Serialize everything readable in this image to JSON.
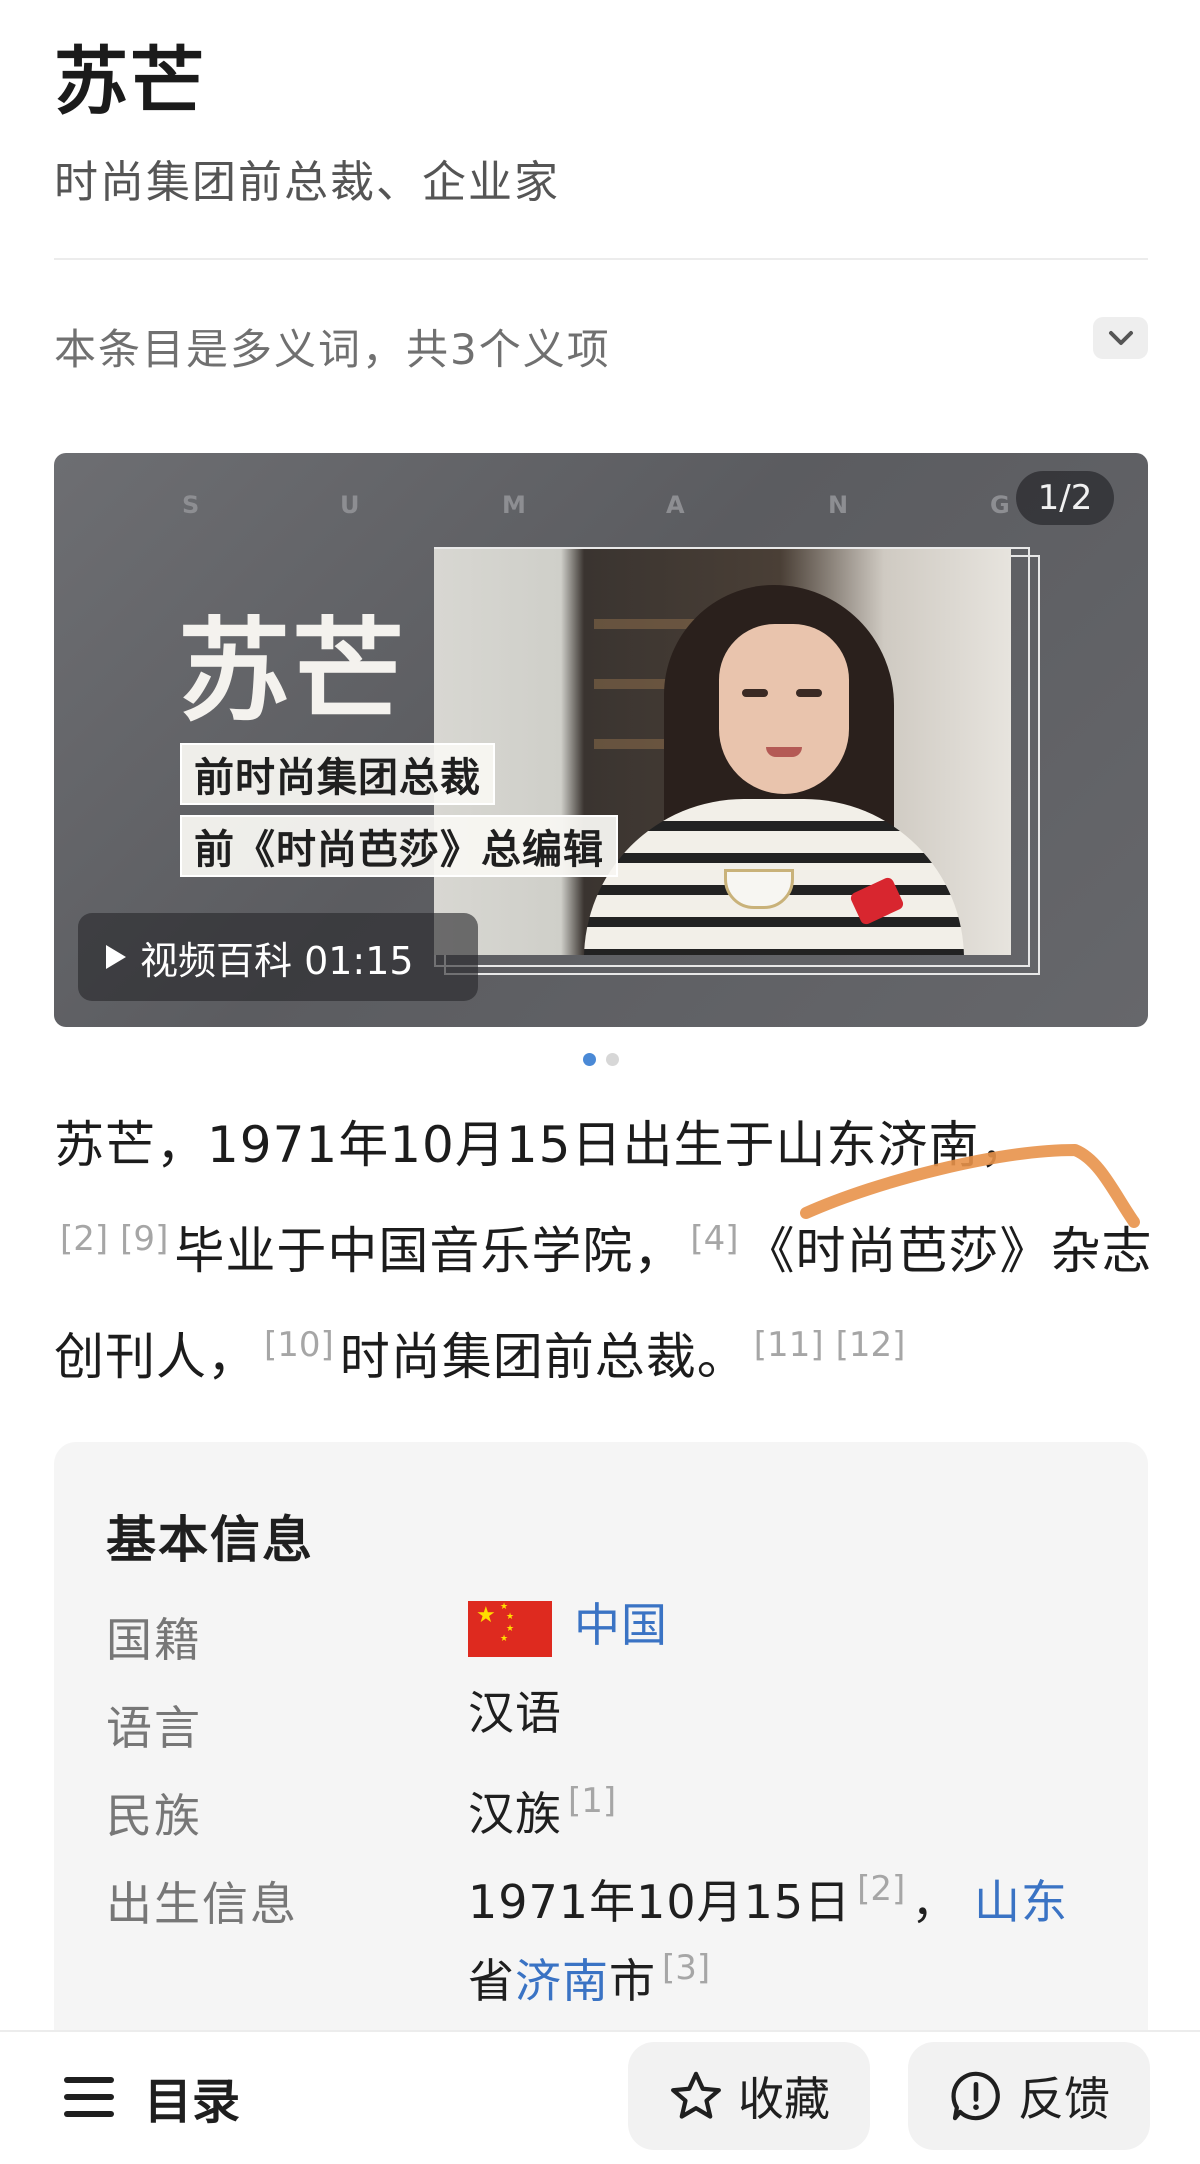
{
  "header": {
    "title": "苏芒",
    "subtitle": "时尚集团前总裁、企业家",
    "polysemy_note": "本条目是多义词，共3个义项"
  },
  "banner": {
    "counter": "1/2",
    "letters": [
      "S",
      "U",
      "M",
      "A",
      "N",
      "G"
    ],
    "name": "苏芒",
    "caption_1": "前时尚集团总裁",
    "caption_2": "前《时尚芭莎》总编辑",
    "video_label": "视频百科 01:15",
    "active_slide": 1,
    "slide_count": 2
  },
  "intro": {
    "part1": "苏芒，1971年10月15日出生于山东济南，",
    "refs1": [
      "[2]",
      "[9]"
    ],
    "part2": "毕业于中国音乐学院，",
    "refs2": [
      "[4]"
    ],
    "part3": "《时尚芭莎》杂志创刊人，",
    "refs3": [
      "[10]"
    ],
    "part4": "时尚集团前总裁。",
    "refs4": [
      "[11]",
      "[12]"
    ],
    "annotation_color": "#E8924A"
  },
  "info_card": {
    "title": "基本信息",
    "rows": [
      {
        "label": "国籍",
        "value": "中国"
      },
      {
        "label": "语言",
        "value": "汉语"
      },
      {
        "label": "民族",
        "value": "汉族",
        "ref": "[1]"
      },
      {
        "label": "出生信息",
        "value_prefix": "1971年10月15日",
        "ref_a": "[2]",
        "comma": "，",
        "link_1": "山东",
        "line2_prefix": "省",
        "link_2": "济南",
        "line2_suffix": "市",
        "ref_b": "[3]"
      }
    ]
  },
  "bottom_bar": {
    "toc_label": "目录",
    "favorite_label": "收藏",
    "feedback_label": "反馈"
  },
  "colors": {
    "link": "#3A73C4",
    "dot_active": "#4A89D6",
    "flag_red": "#DE2A1F",
    "flag_star": "#FFDE00"
  }
}
